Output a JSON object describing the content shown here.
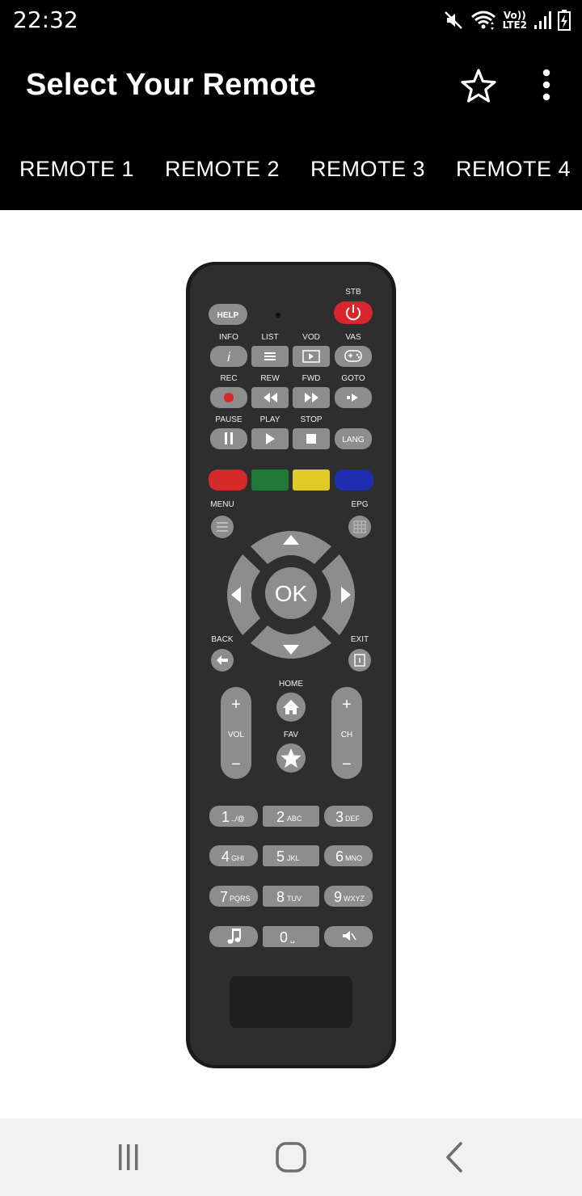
{
  "status_bar": {
    "time": "22:32",
    "network_label_top": "Vo))",
    "network_label_bottom": "LTE2",
    "icons": [
      "mute-icon",
      "wifi-icon",
      "signal-icon",
      "battery-icon"
    ]
  },
  "app_bar": {
    "title": "Select Your Remote",
    "favorite_icon": "star-outline-icon",
    "menu_icon": "more-vert-icon"
  },
  "tabs": [
    {
      "label": "REMOTE 1"
    },
    {
      "label": "REMOTE 2"
    },
    {
      "label": "REMOTE 3"
    },
    {
      "label": "REMOTE 4"
    }
  ],
  "remote": {
    "labels": {
      "stb": "STB",
      "help": "HELP",
      "info": "INFO",
      "list": "LIST",
      "vod": "VOD",
      "vas": "VAS",
      "rec": "REC",
      "rew": "REW",
      "fwd": "FWD",
      "goto": "GOTO",
      "pause": "PAUSE",
      "play": "PLAY",
      "stop": "STOP",
      "lang": "LANG",
      "menu": "MENU",
      "epg": "EPG",
      "ok": "OK",
      "back": "BACK",
      "exit": "EXIT",
      "home": "HOME",
      "vol": "VOL",
      "fav": "FAV",
      "ch": "CH",
      "info_glyph": "i",
      "plus": "+",
      "minus": "−"
    },
    "color_keys": [
      "#d42a2a",
      "#1e7a36",
      "#e1c927",
      "#1f2eb0"
    ],
    "digits": [
      {
        "num": "1",
        "sub": ".,/@"
      },
      {
        "num": "2",
        "sub": "ABC"
      },
      {
        "num": "3",
        "sub": "DEF"
      },
      {
        "num": "4",
        "sub": "GHI"
      },
      {
        "num": "5",
        "sub": "JKL"
      },
      {
        "num": "6",
        "sub": "MNO"
      },
      {
        "num": "7",
        "sub": "PQRS"
      },
      {
        "num": "8",
        "sub": "TUV"
      },
      {
        "num": "9",
        "sub": "WXYZ"
      }
    ],
    "zero": {
      "num": "0",
      "sub": "␣"
    },
    "colors": {
      "body": "#2e2e2e",
      "button": "#8d8d8d",
      "power": "#d7262c"
    }
  },
  "nav_bar": {
    "icons": [
      "recent-apps-icon",
      "home-icon",
      "back-icon"
    ]
  }
}
